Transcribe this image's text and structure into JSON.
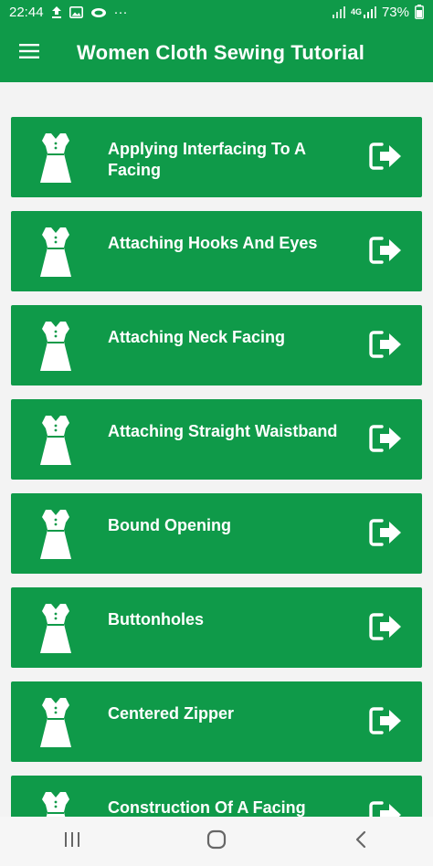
{
  "status_bar": {
    "time": "22:44",
    "more": "···",
    "network_label": "4G",
    "battery_percent": "73%"
  },
  "app_bar": {
    "title": "Women Cloth Sewing Tutorial",
    "menu_icon": "hamburger-menu-icon"
  },
  "colors": {
    "primary": "#0f9a49",
    "card_text": "#ffffff",
    "background": "#f3f3f3"
  },
  "list": {
    "item_icon": "dress-icon",
    "action_icon": "open-arrow-icon",
    "items": [
      {
        "label": "Applying Interfacing To A Facing"
      },
      {
        "label": "Attaching Hooks And Eyes"
      },
      {
        "label": "Attaching Neck Facing"
      },
      {
        "label": "Attaching Straight Waistband"
      },
      {
        "label": "Bound Opening"
      },
      {
        "label": "Buttonholes"
      },
      {
        "label": "Centered Zipper"
      },
      {
        "label": "Construction Of A Facing"
      }
    ]
  },
  "nav_bar": {
    "recents_icon": "recent-apps-icon",
    "home_icon": "home-icon",
    "back_icon": "back-icon"
  }
}
